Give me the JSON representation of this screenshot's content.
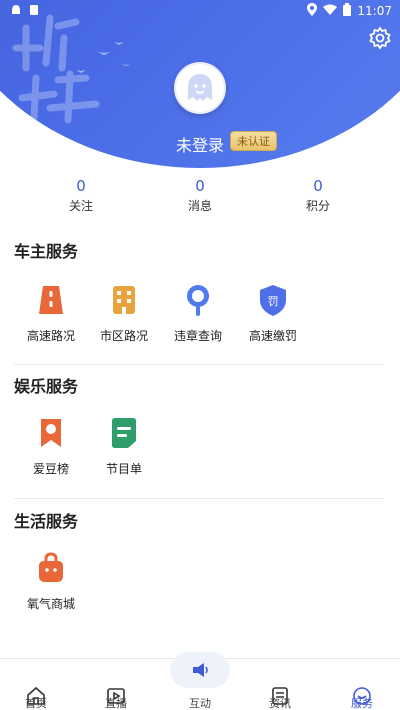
{
  "status_bar": {
    "time": "11:07"
  },
  "header": {
    "username": "未登录",
    "badge": "未认证"
  },
  "stats": [
    {
      "value": "0",
      "label": "关注"
    },
    {
      "value": "0",
      "label": "消息"
    },
    {
      "value": "0",
      "label": "积分"
    }
  ],
  "sections": {
    "car_owner": {
      "title": "车主服务",
      "items": [
        {
          "label": "高速路况",
          "icon": "highway-road-icon",
          "color": "#e8683a"
        },
        {
          "label": "市区路况",
          "icon": "city-building-icon",
          "color": "#e9a33d"
        },
        {
          "label": "违章查询",
          "icon": "search-magnifier-icon",
          "color": "#4f7af0"
        },
        {
          "label": "高速缴罚",
          "icon": "fine-shield-icon",
          "color": "#4f6fe6"
        }
      ]
    },
    "entertainment": {
      "title": "娱乐服务",
      "items": [
        {
          "label": "爱豆榜",
          "icon": "ranking-ribbon-icon",
          "color": "#e8683a"
        },
        {
          "label": "节目单",
          "icon": "program-list-icon",
          "color": "#2f9e6a"
        }
      ]
    },
    "life": {
      "title": "生活服务",
      "items": [
        {
          "label": "氧气商城",
          "icon": "shopping-bag-icon",
          "color": "#e8683a"
        }
      ]
    }
  },
  "bottom_nav": [
    {
      "label": "首页",
      "icon": "home-icon"
    },
    {
      "label": "直播",
      "icon": "live-tv-icon"
    },
    {
      "label": "互动",
      "icon": "megaphone-icon"
    },
    {
      "label": "资讯",
      "icon": "news-icon"
    },
    {
      "label": "服务",
      "icon": "service-icon"
    }
  ],
  "colors": {
    "brand": "#3f5bd6",
    "active_nav": "#3f5bd6"
  }
}
